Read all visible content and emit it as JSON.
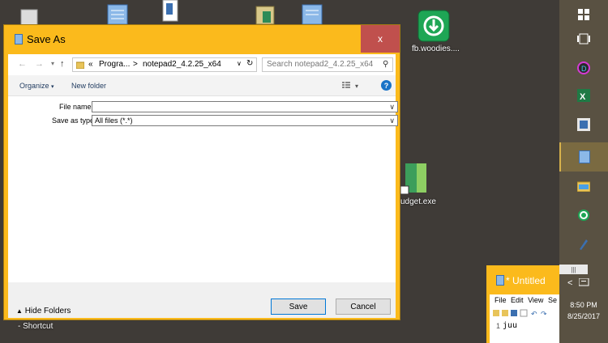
{
  "desktop": {
    "icons": [
      {
        "name": "recycle-bin-icon"
      },
      {
        "name": "notepad-desktop-icon-1"
      },
      {
        "name": "file-desktop-icon"
      },
      {
        "name": "notepad-desktop-icon-2"
      },
      {
        "name": "notepad-desktop-icon-3"
      }
    ],
    "bittorrent_label": "fb.woodies....",
    "budget_label": "udget.exe",
    "shortcut_label": "- Shortcut"
  },
  "dialog": {
    "title": "Save As",
    "close_glyph": "x",
    "nav": {
      "back_glyph": "←",
      "forward_glyph": "→",
      "up_glyph": "↑",
      "breadcrumb_prefix": "«",
      "breadcrumb_1": "Progra...",
      "separator": ">",
      "breadcrumb_2": "notepad2_4.2.25_x64",
      "search_placeholder": "Search notepad2_4.2.25_x64"
    },
    "toolbar": {
      "organize_label": "Organize",
      "new_folder_label": "New folder",
      "help_glyph": "?"
    },
    "form": {
      "file_name_label": "File name:",
      "file_name_value": "",
      "save_type_label": "Save as type:",
      "save_type_value": "All files (*.*)"
    },
    "footer": {
      "hide_folders_label": "Hide Folders",
      "save_label": "Save",
      "cancel_label": "Cancel"
    }
  },
  "taskbar": {
    "time": "8:50 PM",
    "date": "8/25/2017",
    "chevron_glyph": "<"
  },
  "notepad": {
    "title": "* Untitled",
    "menu": [
      "File",
      "Edit",
      "View",
      "Se"
    ],
    "line_number": "1",
    "content": "juu"
  },
  "colors": {
    "accent": "#fbba1c",
    "close_red": "#c0504d",
    "desktop": "#3f3b37",
    "taskbar": "#595142"
  }
}
